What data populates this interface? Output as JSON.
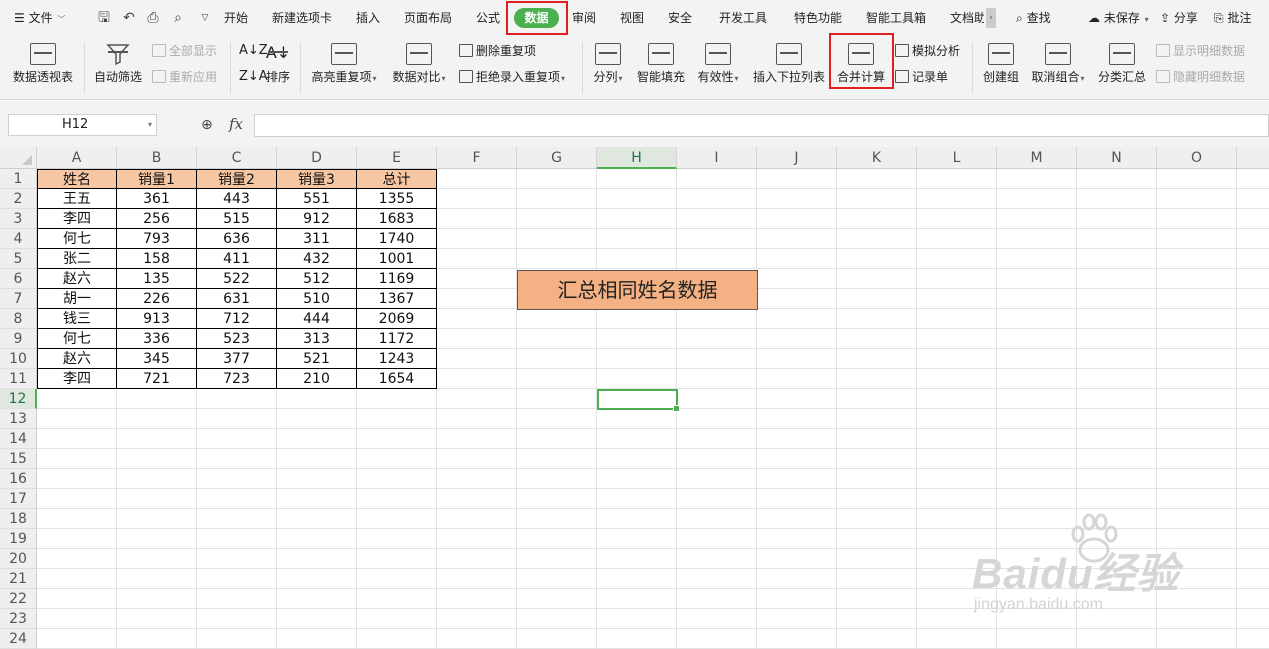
{
  "menu": {
    "file_label": "文件",
    "tabs": [
      "开始",
      "新建选项卡",
      "插入",
      "页面布局",
      "公式",
      "数据",
      "审阅",
      "视图",
      "安全",
      "开发工具",
      "特色功能",
      "智能工具箱",
      "文档助"
    ],
    "active_tab": "数据",
    "search_label": "查找",
    "unsaved_label": "未保存",
    "share_label": "分享",
    "comment_label": "批注"
  },
  "ribbon": {
    "pivot": "数据透视表",
    "autofilter": "自动筛选",
    "show_all": "全部显示",
    "reapply": "重新应用",
    "sort": "排序",
    "highlight_dup": "高亮重复项",
    "compare": "数据对比",
    "remove_dup": "删除重复项",
    "reject_dup": "拒绝录入重复项",
    "split": "分列",
    "smart_fill": "智能填充",
    "validity": "有效性",
    "insert_dropdown": "插入下拉列表",
    "consolidate": "合并计算",
    "what_if": "模拟分析",
    "record": "记录单",
    "group": "创建组",
    "ungroup": "取消组合",
    "subtotal": "分类汇总",
    "show_detail": "显示明细数据",
    "hide_detail": "隐藏明细数据"
  },
  "formula_bar": {
    "name_box": "H12",
    "fx": "fx",
    "value": ""
  },
  "columns": [
    "A",
    "B",
    "C",
    "D",
    "E",
    "F",
    "G",
    "H",
    "I",
    "J",
    "K",
    "L",
    "M",
    "N",
    "O"
  ],
  "selected_column": "H",
  "rows": [
    "1",
    "2",
    "3",
    "4",
    "5",
    "6",
    "7",
    "8",
    "9",
    "10",
    "11",
    "12",
    "13",
    "14",
    "15",
    "16",
    "17",
    "18",
    "19",
    "20",
    "21",
    "22",
    "23",
    "24"
  ],
  "selected_row": "12",
  "table": {
    "headers": [
      "姓名",
      "销量1",
      "销量2",
      "销量3",
      "总计"
    ],
    "rows": [
      [
        "王五",
        "361",
        "443",
        "551",
        "1355"
      ],
      [
        "李四",
        "256",
        "515",
        "912",
        "1683"
      ],
      [
        "何七",
        "793",
        "636",
        "311",
        "1740"
      ],
      [
        "张二",
        "158",
        "411",
        "432",
        "1001"
      ],
      [
        "赵六",
        "135",
        "522",
        "512",
        "1169"
      ],
      [
        "胡一",
        "226",
        "631",
        "510",
        "1367"
      ],
      [
        "钱三",
        "913",
        "712",
        "444",
        "2069"
      ],
      [
        "何七",
        "336",
        "523",
        "313",
        "1172"
      ],
      [
        "赵六",
        "345",
        "377",
        "521",
        "1243"
      ],
      [
        "李四",
        "721",
        "723",
        "210",
        "1654"
      ]
    ]
  },
  "summary_box_text": "汇总相同姓名数据",
  "watermark": {
    "main": "Baidu经验",
    "sub": "jingyan.baidu.com"
  },
  "colors": {
    "accent": "#4caf50",
    "highlight_box": "#e02020",
    "header_fill": "#f7c6a3",
    "summary_fill": "#f4b183"
  }
}
